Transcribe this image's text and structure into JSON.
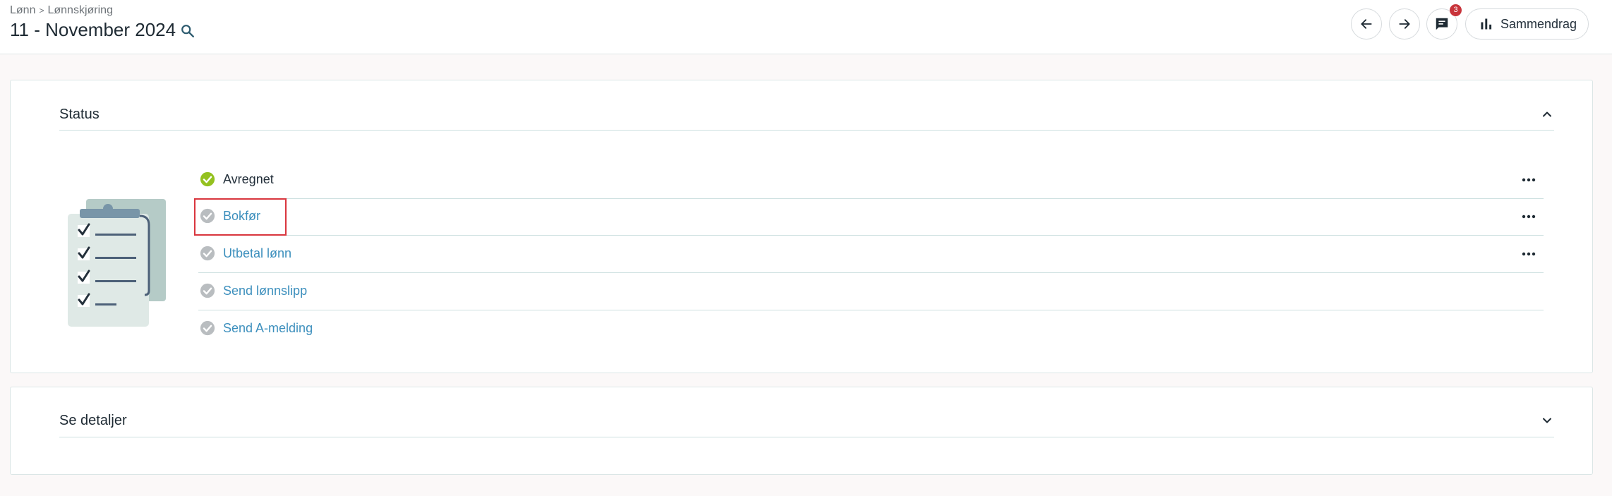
{
  "breadcrumb": {
    "root": "Lønn",
    "separator": ">",
    "current": "Lønnskjøring"
  },
  "header": {
    "title": "11 - November 2024"
  },
  "toolbar": {
    "back_icon": "arrow-left-icon",
    "forward_icon": "arrow-right-icon",
    "comments_icon": "comment-icon",
    "comments_count": "3",
    "summary_label": "Sammendrag",
    "summary_icon": "bar-chart-icon"
  },
  "status_card": {
    "title": "Status",
    "expanded": true,
    "steps": [
      {
        "label": "Avregnet",
        "state": "done",
        "has_menu": true
      },
      {
        "label": "Bokfør",
        "state": "pending",
        "has_menu": true
      },
      {
        "label": "Utbetal lønn",
        "state": "pending",
        "has_menu": true
      },
      {
        "label": "Send lønnslipp",
        "state": "pending",
        "has_menu": false
      },
      {
        "label": "Send A-melding",
        "state": "pending",
        "has_menu": false
      }
    ]
  },
  "details_card": {
    "title": "Se detaljer",
    "expanded": false
  },
  "colors": {
    "done": "#94c11f",
    "pending": "#b9bdc0",
    "link": "#3c8fbd",
    "highlight": "#d9363e",
    "badge": "#c8343b"
  }
}
